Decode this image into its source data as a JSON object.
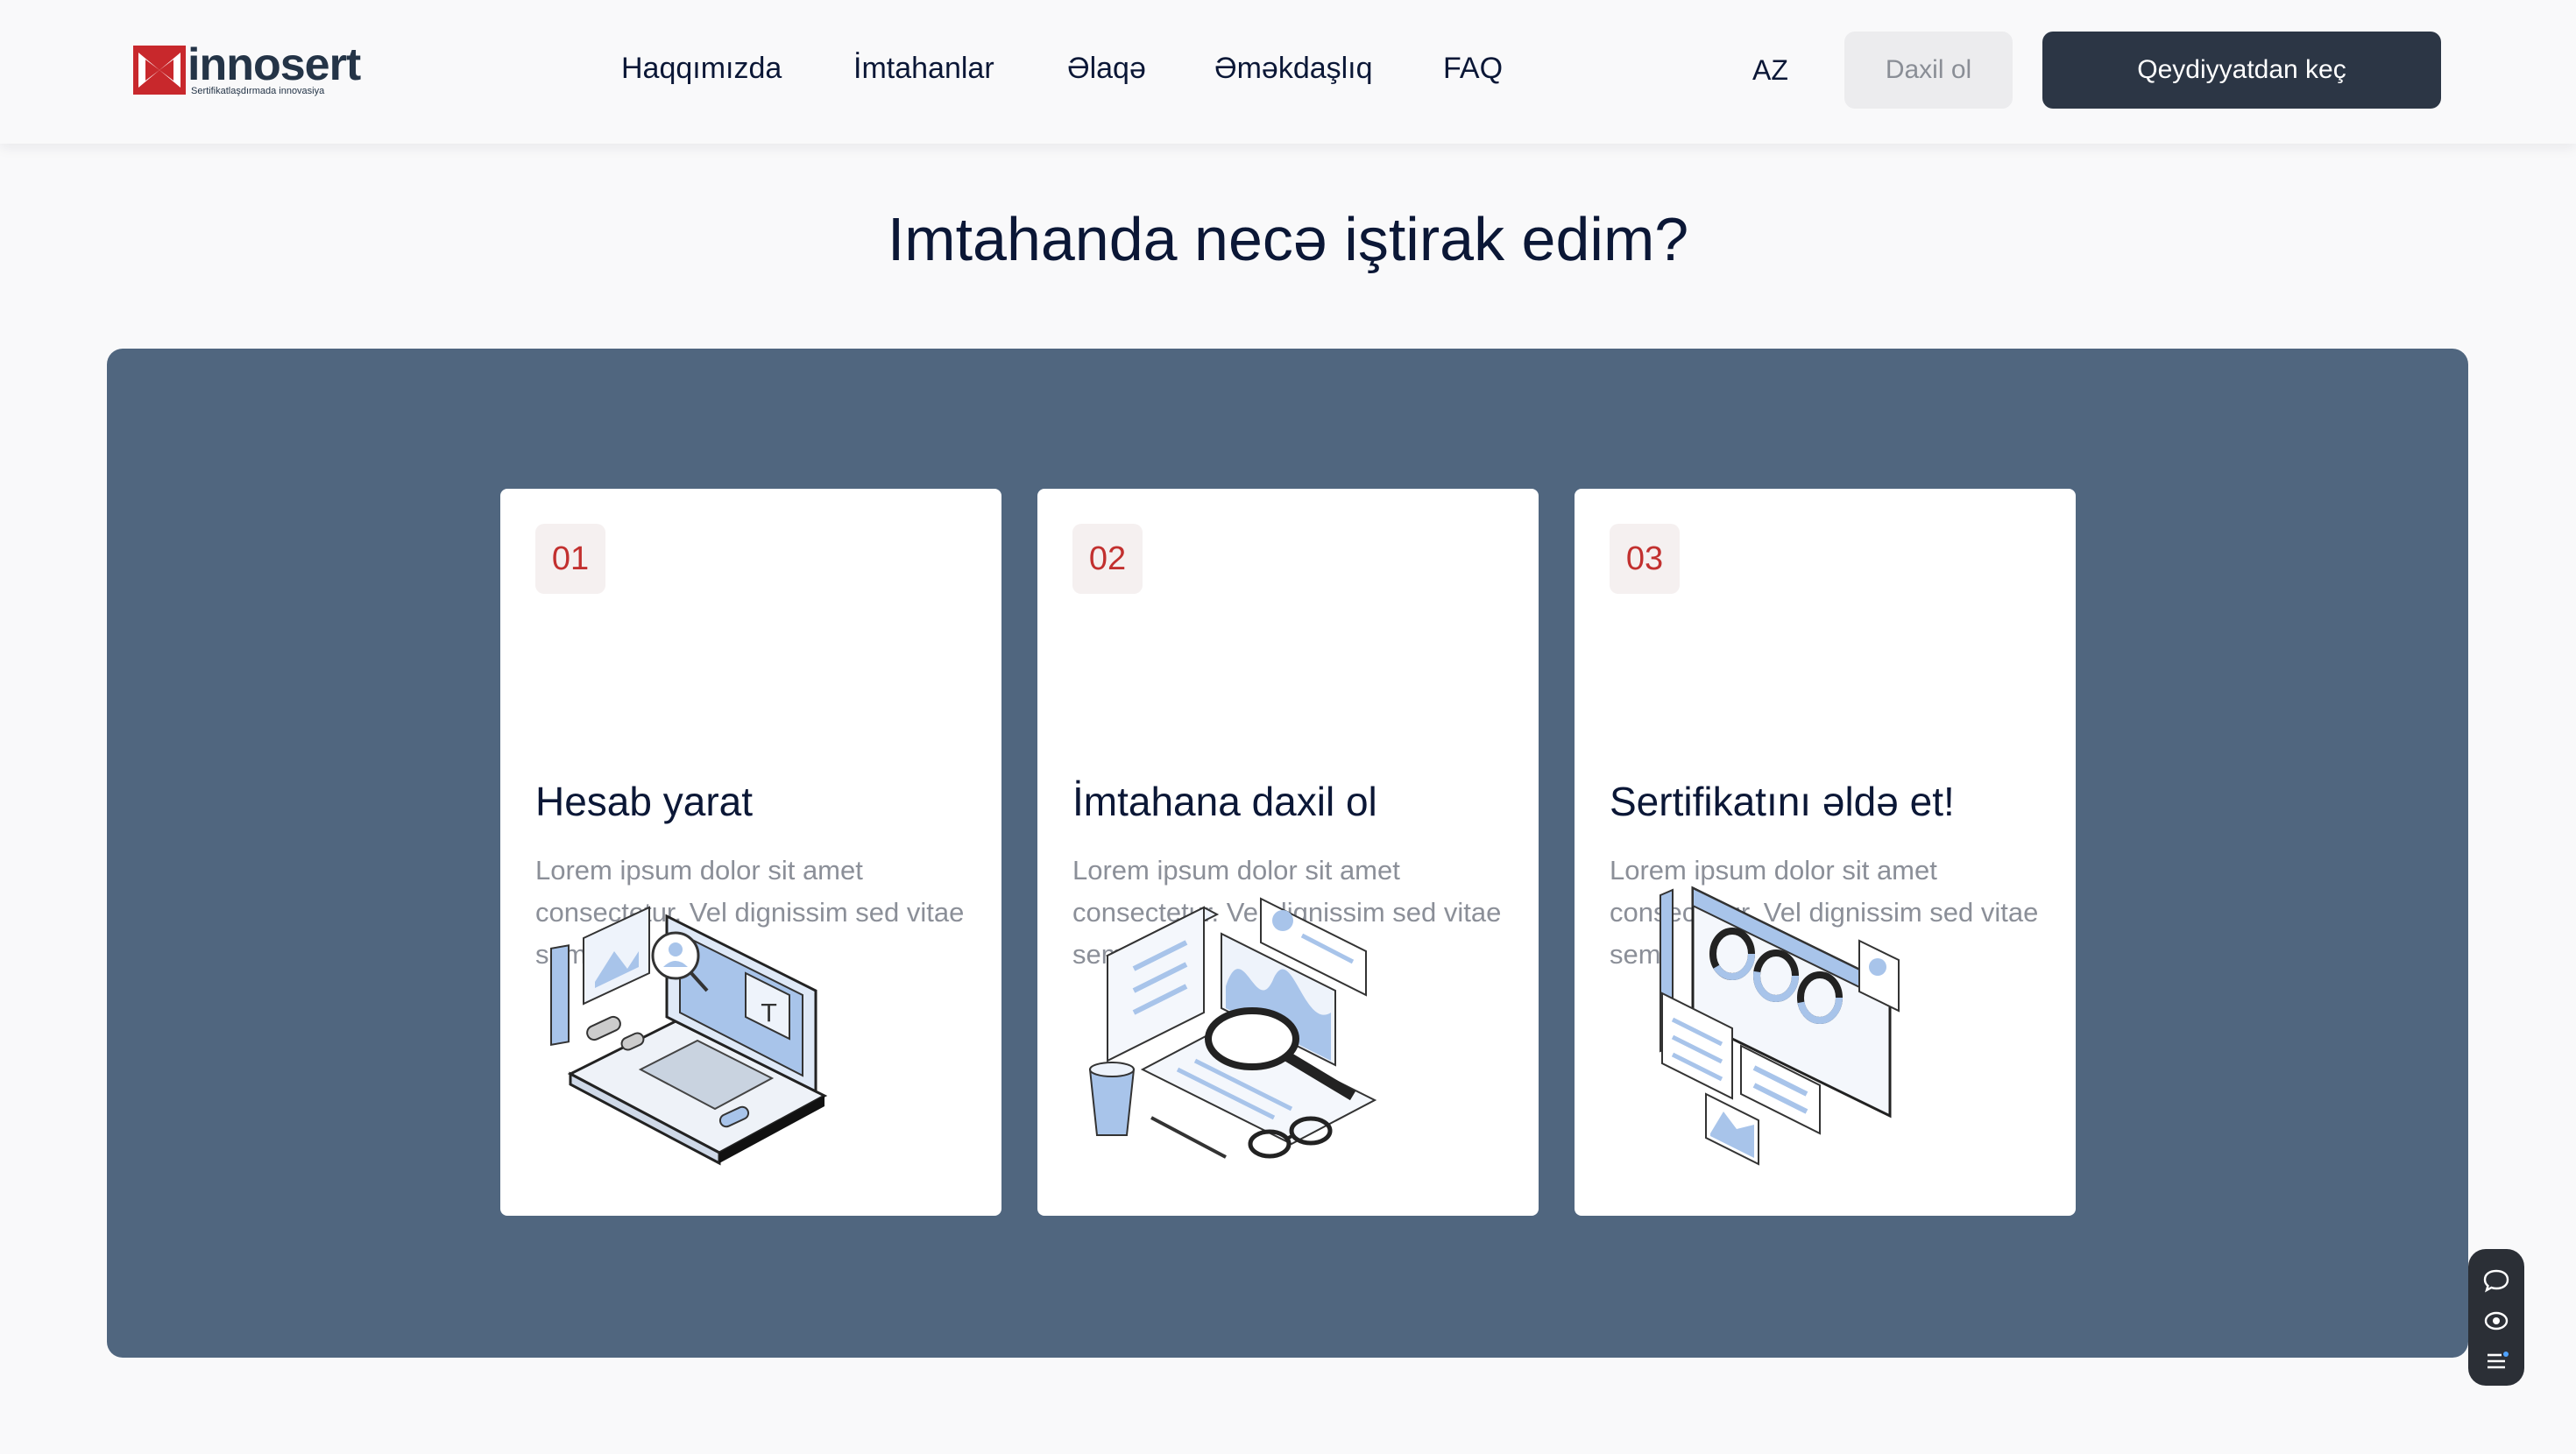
{
  "header": {
    "logo": {
      "name": "innosert",
      "tagline": "Sertifikatlaşdırmada innovasiya"
    },
    "nav": [
      {
        "label": "Haqqımızda"
      },
      {
        "label": "İmtahanlar"
      },
      {
        "label": "Əlaqə"
      },
      {
        "label": "Əməkdaşlıq"
      },
      {
        "label": "FAQ"
      }
    ],
    "language": "AZ",
    "login_label": "Daxil ol",
    "register_label": "Qeydiyyatdan keç"
  },
  "main": {
    "title": "Imtahanda necə iştirak edim?",
    "steps": [
      {
        "number": "01",
        "title": "Hesab yarat",
        "text": "Lorem ipsum dolor sit amet consectetur. Vel dignissim sed vitae sem.",
        "illustration": "laptop-account-illustration"
      },
      {
        "number": "02",
        "title": "İmtahana daxil ol",
        "text": "Lorem ipsum dolor sit amet consectetur. Vel dignissim sed vitae sem.",
        "illustration": "exam-magnifier-illustration"
      },
      {
        "number": "03",
        "title": "Sertifikatını əldə et!",
        "text": "Lorem ipsum dolor sit amet consectetur. Vel dignissim sed vitae sem.",
        "illustration": "dashboard-charts-illustration"
      }
    ]
  },
  "floating_widget": {
    "icons": [
      "chat-icon",
      "eye-icon",
      "menu-icon"
    ]
  },
  "colors": {
    "brand_red": "#c8282c",
    "navy_text": "#0b1736",
    "panel_bg": "#50667f",
    "dark_button": "#2c3645",
    "light_button": "#ececee",
    "illustration_blue": "#a8c4ea"
  }
}
